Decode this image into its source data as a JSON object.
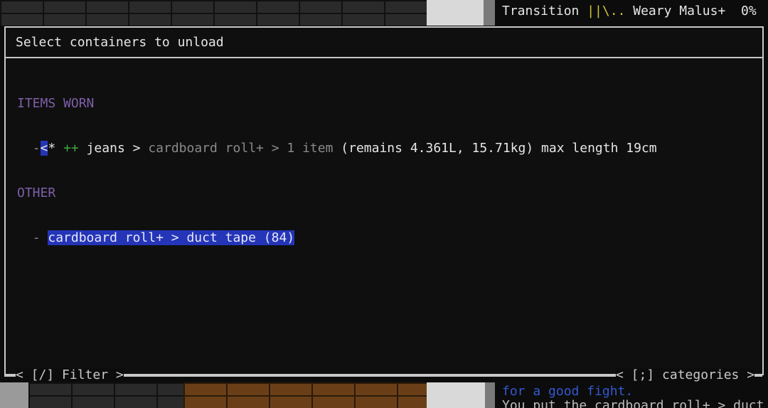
{
  "top_panel": {
    "line1_left": "Transition",
    "line1_bars": "||\\..",
    "line1_status": "Weary Malus+",
    "line1_pct": "0%"
  },
  "dialog": {
    "title": "Select containers to unload",
    "categories": [
      {
        "name": "ITEMS WORN",
        "rows": [
          {
            "prefix": "-",
            "marker": "<",
            "marker2": "*",
            "plus": "++",
            "item": "jeans",
            "arrow1": ">",
            "container": "cardboard roll+",
            "arrow2": ">",
            "count": "1 item",
            "details": "(remains 4.361L, 15.71kg) max length 19cm"
          }
        ]
      },
      {
        "name": "OTHER",
        "rows": [
          {
            "prefix": "-",
            "text": "cardboard roll+ > duct tape (84)"
          }
        ]
      }
    ]
  },
  "footer": {
    "filter": "< [/] Filter >",
    "categories": "< [;] categories >"
  },
  "bottom_panel": {
    "msg1": "for a good fight.",
    "msg2": "You put the cardboard roll+ > duct"
  },
  "colors": {
    "highlight": "#2435b8",
    "category": "#7f5fa8",
    "plus": "#3fa83f",
    "border": "#c8c8c8"
  }
}
